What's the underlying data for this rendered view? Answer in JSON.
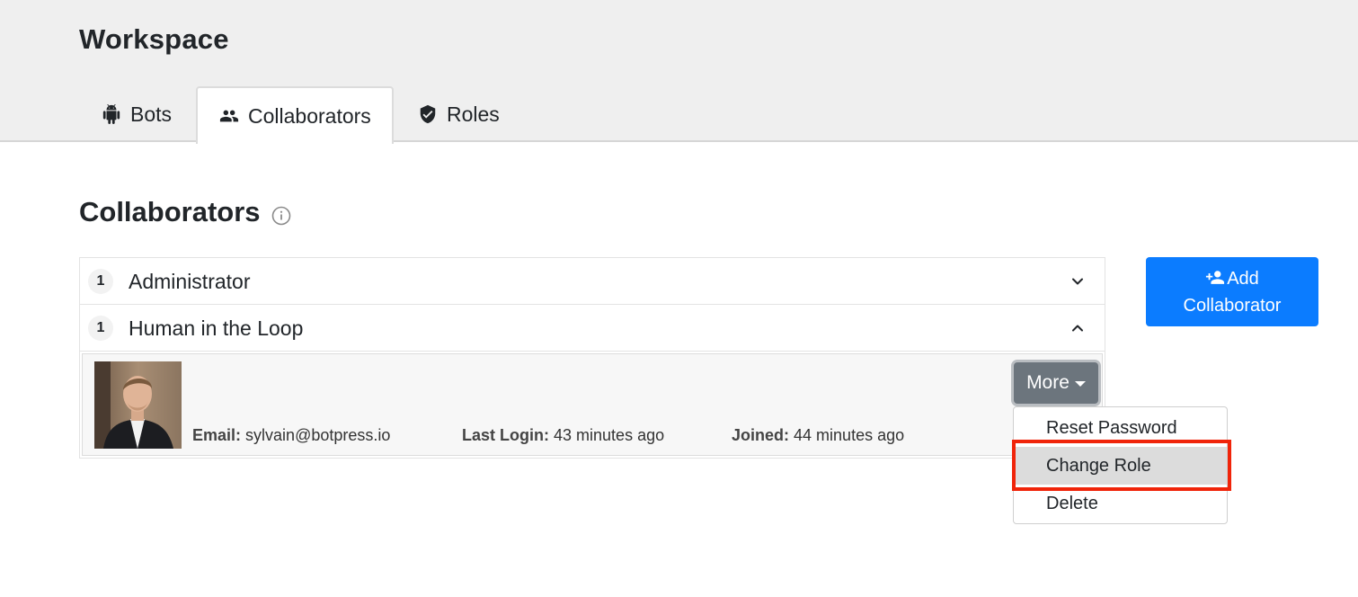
{
  "header": {
    "title": "Workspace",
    "tabs": [
      {
        "label": "Bots",
        "icon": "android-icon"
      },
      {
        "label": "Collaborators",
        "icon": "people-icon",
        "active": true
      },
      {
        "label": "Roles",
        "icon": "shield-icon"
      }
    ]
  },
  "section": {
    "title": "Collaborators",
    "info_icon": "info-icon"
  },
  "roles": [
    {
      "count": "1",
      "label": "Administrator",
      "expanded": false
    },
    {
      "count": "1",
      "label": "Human in the Loop",
      "expanded": true
    }
  ],
  "user": {
    "email_label": "Email:",
    "email": "sylvain@botpress.io",
    "last_login_label": "Last Login:",
    "last_login": "43 minutes ago",
    "joined_label": "Joined:",
    "joined": "44 minutes ago",
    "more_label": "More"
  },
  "dropdown": {
    "items": [
      "Reset Password",
      "Change Role",
      "Delete"
    ],
    "highlighted": "Change Role",
    "highlight_color": "#f0240a"
  },
  "add_button": {
    "line1": "Add",
    "line2": "Collaborator",
    "color": "#0b7cff"
  }
}
